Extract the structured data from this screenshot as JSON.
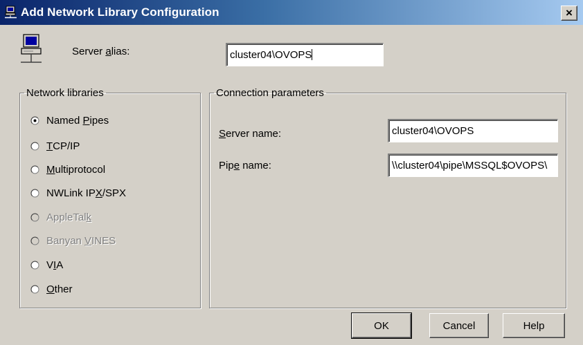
{
  "window": {
    "title": "Add Network Library Configuration",
    "close_glyph": "×"
  },
  "alias": {
    "label_pre": "Server ",
    "label_ul": "a",
    "label_post": "lias:",
    "value": "cluster04\\OVOPS"
  },
  "network_libraries": {
    "legend": "Network libraries",
    "options": [
      {
        "pre": "Named ",
        "ul": "P",
        "post": "ipes",
        "selected": true,
        "enabled": true
      },
      {
        "pre": "",
        "ul": "T",
        "post": "CP/IP",
        "selected": false,
        "enabled": true
      },
      {
        "pre": "",
        "ul": "M",
        "post": "ultiprotocol",
        "selected": false,
        "enabled": true
      },
      {
        "pre": "NWLink IP",
        "ul": "X",
        "post": "/SPX",
        "selected": false,
        "enabled": true
      },
      {
        "pre": "AppleTal",
        "ul": "k",
        "post": "",
        "selected": false,
        "enabled": false
      },
      {
        "pre": "Banyan ",
        "ul": "V",
        "post": "INES",
        "selected": false,
        "enabled": false
      },
      {
        "pre": "V",
        "ul": "I",
        "post": "A",
        "selected": false,
        "enabled": true
      },
      {
        "pre": "",
        "ul": "O",
        "post": "ther",
        "selected": false,
        "enabled": true
      }
    ]
  },
  "connection": {
    "legend": "Connection parameters",
    "server_name": {
      "label_pre": "",
      "label_ul": "S",
      "label_post": "erver name:",
      "value": "cluster04\\OVOPS"
    },
    "pipe_name": {
      "label_pre": "Pip",
      "label_ul": "e",
      "label_post": " name:",
      "value": "\\\\cluster04\\pipe\\MSSQL$OVOPS\\"
    }
  },
  "buttons": {
    "ok": "OK",
    "cancel": "Cancel",
    "help": "Help"
  },
  "icons": {
    "title": "network-computer-icon",
    "server": "network-computer-icon",
    "close": "close-icon"
  }
}
